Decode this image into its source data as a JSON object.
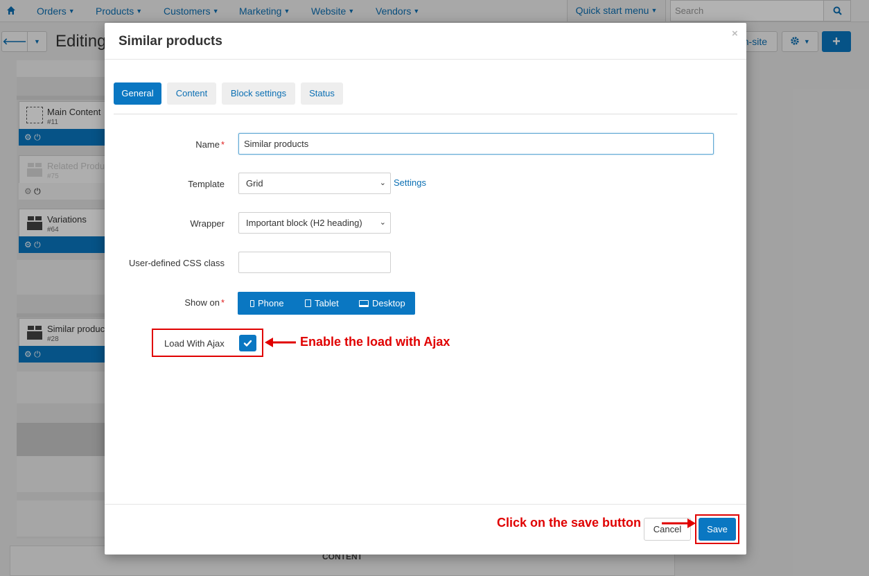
{
  "topnav": {
    "items": [
      {
        "label": "Orders"
      },
      {
        "label": "Products"
      },
      {
        "label": "Customers"
      },
      {
        "label": "Marketing"
      },
      {
        "label": "Website"
      },
      {
        "label": "Vendors"
      }
    ],
    "quick_start": "Quick start menu",
    "search_placeholder": "Search"
  },
  "page": {
    "title": "Editing",
    "onsite_label": "n-site"
  },
  "layout_blocks": [
    {
      "name": "Main Content",
      "id": "#11",
      "enabled": true
    },
    {
      "name": "Related Produc",
      "id": "#75",
      "enabled": false
    },
    {
      "name": "Variations",
      "id": "#64",
      "enabled": true
    },
    {
      "name": "Similar produc",
      "id": "#28",
      "enabled": true
    }
  ],
  "footer_content_label": "CONTENT",
  "modal": {
    "title": "Similar products",
    "close": "×",
    "tabs": [
      {
        "label": "General",
        "active": true
      },
      {
        "label": "Content",
        "active": false
      },
      {
        "label": "Block settings",
        "active": false
      },
      {
        "label": "Status",
        "active": false
      }
    ],
    "form": {
      "name_label": "Name",
      "name_value": "Similar products",
      "template_label": "Template",
      "template_value": "Grid",
      "settings_link": "Settings",
      "wrapper_label": "Wrapper",
      "wrapper_value": "Important block (H2 heading)",
      "css_label": "User-defined CSS class",
      "css_value": "",
      "showon_label": "Show on",
      "showon_options": [
        {
          "label": "Phone"
        },
        {
          "label": "Tablet"
        },
        {
          "label": "Desktop"
        }
      ],
      "ajax_label": "Load With Ajax",
      "ajax_checked": true,
      "required_mark": "*"
    },
    "buttons": {
      "cancel": "Cancel",
      "save": "Save"
    }
  },
  "annotations": {
    "ajax": "Enable the load with Ajax",
    "save": "Click on the save button"
  },
  "colors": {
    "primary": "#0a77c2",
    "annotation": "#e00000"
  }
}
